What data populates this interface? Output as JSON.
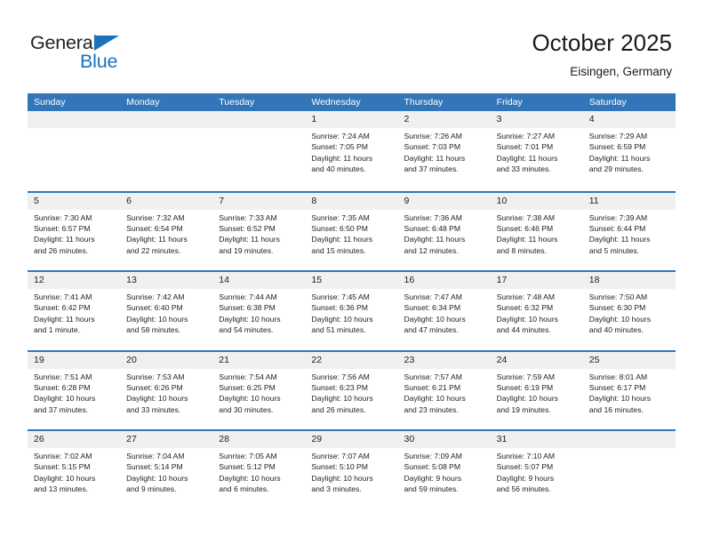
{
  "brand": {
    "name_part1": "General",
    "name_part2": "Blue",
    "triangle_color": "#1b72b8",
    "text_color": "#231f20"
  },
  "header": {
    "title": "October 2025",
    "subtitle": "Eisingen, Germany"
  },
  "theme": {
    "header_blue": "#3276b9",
    "daynum_band": "#f0f0f0",
    "text": "#222222"
  },
  "weekdays": [
    "Sunday",
    "Monday",
    "Tuesday",
    "Wednesday",
    "Thursday",
    "Friday",
    "Saturday"
  ],
  "labels": {
    "sunrise_prefix": "Sunrise:",
    "sunset_prefix": "Sunset:",
    "daylight_prefix": "Daylight:"
  },
  "weeks": [
    [
      {
        "empty": true
      },
      {
        "empty": true
      },
      {
        "empty": true
      },
      {
        "day": "1",
        "sunrise": "Sunrise: 7:24 AM",
        "sunset": "Sunset: 7:05 PM",
        "daylight_l1": "Daylight: 11 hours",
        "daylight_l2": "and 40 minutes."
      },
      {
        "day": "2",
        "sunrise": "Sunrise: 7:26 AM",
        "sunset": "Sunset: 7:03 PM",
        "daylight_l1": "Daylight: 11 hours",
        "daylight_l2": "and 37 minutes."
      },
      {
        "day": "3",
        "sunrise": "Sunrise: 7:27 AM",
        "sunset": "Sunset: 7:01 PM",
        "daylight_l1": "Daylight: 11 hours",
        "daylight_l2": "and 33 minutes."
      },
      {
        "day": "4",
        "sunrise": "Sunrise: 7:29 AM",
        "sunset": "Sunset: 6:59 PM",
        "daylight_l1": "Daylight: 11 hours",
        "daylight_l2": "and 29 minutes."
      }
    ],
    [
      {
        "day": "5",
        "sunrise": "Sunrise: 7:30 AM",
        "sunset": "Sunset: 6:57 PM",
        "daylight_l1": "Daylight: 11 hours",
        "daylight_l2": "and 26 minutes."
      },
      {
        "day": "6",
        "sunrise": "Sunrise: 7:32 AM",
        "sunset": "Sunset: 6:54 PM",
        "daylight_l1": "Daylight: 11 hours",
        "daylight_l2": "and 22 minutes."
      },
      {
        "day": "7",
        "sunrise": "Sunrise: 7:33 AM",
        "sunset": "Sunset: 6:52 PM",
        "daylight_l1": "Daylight: 11 hours",
        "daylight_l2": "and 19 minutes."
      },
      {
        "day": "8",
        "sunrise": "Sunrise: 7:35 AM",
        "sunset": "Sunset: 6:50 PM",
        "daylight_l1": "Daylight: 11 hours",
        "daylight_l2": "and 15 minutes."
      },
      {
        "day": "9",
        "sunrise": "Sunrise: 7:36 AM",
        "sunset": "Sunset: 6:48 PM",
        "daylight_l1": "Daylight: 11 hours",
        "daylight_l2": "and 12 minutes."
      },
      {
        "day": "10",
        "sunrise": "Sunrise: 7:38 AM",
        "sunset": "Sunset: 6:46 PM",
        "daylight_l1": "Daylight: 11 hours",
        "daylight_l2": "and 8 minutes."
      },
      {
        "day": "11",
        "sunrise": "Sunrise: 7:39 AM",
        "sunset": "Sunset: 6:44 PM",
        "daylight_l1": "Daylight: 11 hours",
        "daylight_l2": "and 5 minutes."
      }
    ],
    [
      {
        "day": "12",
        "sunrise": "Sunrise: 7:41 AM",
        "sunset": "Sunset: 6:42 PM",
        "daylight_l1": "Daylight: 11 hours",
        "daylight_l2": "and 1 minute."
      },
      {
        "day": "13",
        "sunrise": "Sunrise: 7:42 AM",
        "sunset": "Sunset: 6:40 PM",
        "daylight_l1": "Daylight: 10 hours",
        "daylight_l2": "and 58 minutes."
      },
      {
        "day": "14",
        "sunrise": "Sunrise: 7:44 AM",
        "sunset": "Sunset: 6:38 PM",
        "daylight_l1": "Daylight: 10 hours",
        "daylight_l2": "and 54 minutes."
      },
      {
        "day": "15",
        "sunrise": "Sunrise: 7:45 AM",
        "sunset": "Sunset: 6:36 PM",
        "daylight_l1": "Daylight: 10 hours",
        "daylight_l2": "and 51 minutes."
      },
      {
        "day": "16",
        "sunrise": "Sunrise: 7:47 AM",
        "sunset": "Sunset: 6:34 PM",
        "daylight_l1": "Daylight: 10 hours",
        "daylight_l2": "and 47 minutes."
      },
      {
        "day": "17",
        "sunrise": "Sunrise: 7:48 AM",
        "sunset": "Sunset: 6:32 PM",
        "daylight_l1": "Daylight: 10 hours",
        "daylight_l2": "and 44 minutes."
      },
      {
        "day": "18",
        "sunrise": "Sunrise: 7:50 AM",
        "sunset": "Sunset: 6:30 PM",
        "daylight_l1": "Daylight: 10 hours",
        "daylight_l2": "and 40 minutes."
      }
    ],
    [
      {
        "day": "19",
        "sunrise": "Sunrise: 7:51 AM",
        "sunset": "Sunset: 6:28 PM",
        "daylight_l1": "Daylight: 10 hours",
        "daylight_l2": "and 37 minutes."
      },
      {
        "day": "20",
        "sunrise": "Sunrise: 7:53 AM",
        "sunset": "Sunset: 6:26 PM",
        "daylight_l1": "Daylight: 10 hours",
        "daylight_l2": "and 33 minutes."
      },
      {
        "day": "21",
        "sunrise": "Sunrise: 7:54 AM",
        "sunset": "Sunset: 6:25 PM",
        "daylight_l1": "Daylight: 10 hours",
        "daylight_l2": "and 30 minutes."
      },
      {
        "day": "22",
        "sunrise": "Sunrise: 7:56 AM",
        "sunset": "Sunset: 6:23 PM",
        "daylight_l1": "Daylight: 10 hours",
        "daylight_l2": "and 26 minutes."
      },
      {
        "day": "23",
        "sunrise": "Sunrise: 7:57 AM",
        "sunset": "Sunset: 6:21 PM",
        "daylight_l1": "Daylight: 10 hours",
        "daylight_l2": "and 23 minutes."
      },
      {
        "day": "24",
        "sunrise": "Sunrise: 7:59 AM",
        "sunset": "Sunset: 6:19 PM",
        "daylight_l1": "Daylight: 10 hours",
        "daylight_l2": "and 19 minutes."
      },
      {
        "day": "25",
        "sunrise": "Sunrise: 8:01 AM",
        "sunset": "Sunset: 6:17 PM",
        "daylight_l1": "Daylight: 10 hours",
        "daylight_l2": "and 16 minutes."
      }
    ],
    [
      {
        "day": "26",
        "sunrise": "Sunrise: 7:02 AM",
        "sunset": "Sunset: 5:15 PM",
        "daylight_l1": "Daylight: 10 hours",
        "daylight_l2": "and 13 minutes."
      },
      {
        "day": "27",
        "sunrise": "Sunrise: 7:04 AM",
        "sunset": "Sunset: 5:14 PM",
        "daylight_l1": "Daylight: 10 hours",
        "daylight_l2": "and 9 minutes."
      },
      {
        "day": "28",
        "sunrise": "Sunrise: 7:05 AM",
        "sunset": "Sunset: 5:12 PM",
        "daylight_l1": "Daylight: 10 hours",
        "daylight_l2": "and 6 minutes."
      },
      {
        "day": "29",
        "sunrise": "Sunrise: 7:07 AM",
        "sunset": "Sunset: 5:10 PM",
        "daylight_l1": "Daylight: 10 hours",
        "daylight_l2": "and 3 minutes."
      },
      {
        "day": "30",
        "sunrise": "Sunrise: 7:09 AM",
        "sunset": "Sunset: 5:08 PM",
        "daylight_l1": "Daylight: 9 hours",
        "daylight_l2": "and 59 minutes."
      },
      {
        "day": "31",
        "sunrise": "Sunrise: 7:10 AM",
        "sunset": "Sunset: 5:07 PM",
        "daylight_l1": "Daylight: 9 hours",
        "daylight_l2": "and 56 minutes."
      },
      {
        "empty": true
      }
    ]
  ]
}
